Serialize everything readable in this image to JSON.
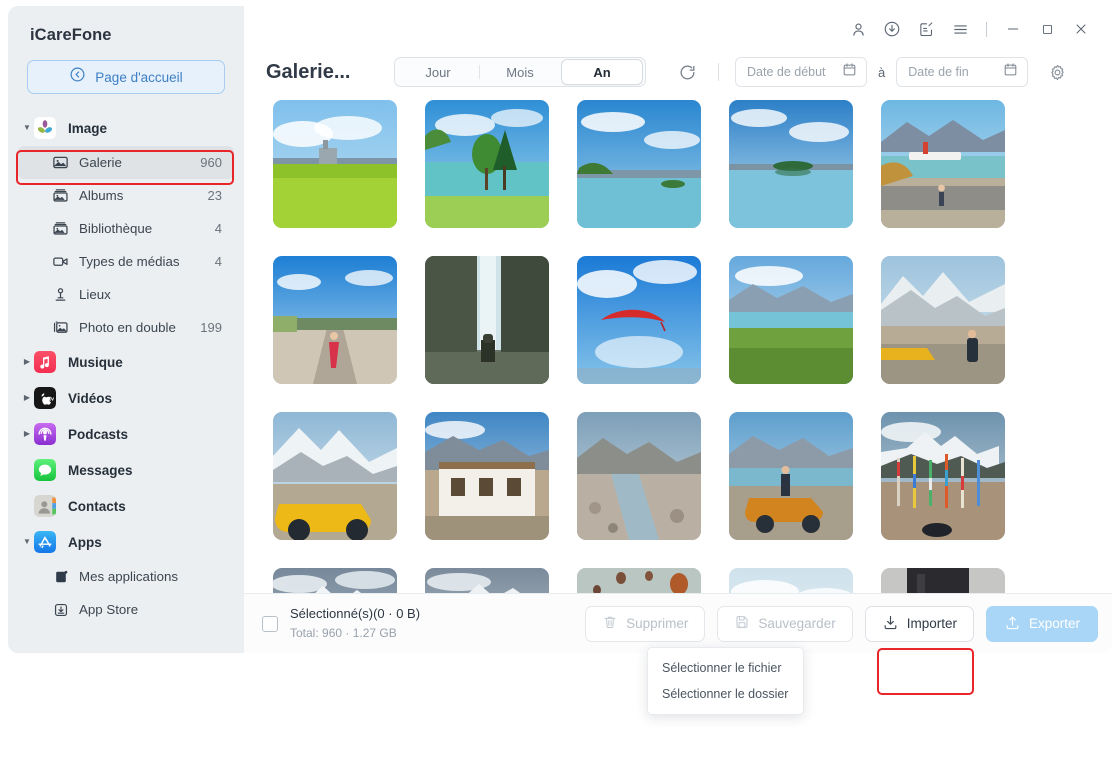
{
  "app": {
    "title": "iCareFone"
  },
  "sidebar": {
    "home_button": {
      "label": "Page d'accueil",
      "icon": "back-circle-icon"
    },
    "groups": [
      {
        "id": "image",
        "label": "Image",
        "expanded": true,
        "icon": "photos-app-icon",
        "items": [
          {
            "id": "galerie",
            "label": "Galerie",
            "count": "960",
            "icon": "picture-icon",
            "active": true,
            "highlighted": true
          },
          {
            "id": "albums",
            "label": "Albums",
            "count": "23",
            "icon": "album-icon",
            "active": false
          },
          {
            "id": "bibliotheque",
            "label": "Bibliothèque",
            "count": "4",
            "icon": "library-icon",
            "active": false
          },
          {
            "id": "types-de-medias",
            "label": "Types de médias",
            "count": "4",
            "icon": "video-camera-icon",
            "active": false
          },
          {
            "id": "lieux",
            "label": "Lieux",
            "count": "",
            "icon": "location-pin-icon",
            "active": false
          },
          {
            "id": "photo-en-double",
            "label": "Photo en double",
            "count": "199",
            "icon": "duplicate-photo-icon",
            "active": false
          }
        ]
      },
      {
        "id": "musique",
        "label": "Musique",
        "expanded": false,
        "icon": "music-app-icon",
        "items": []
      },
      {
        "id": "videos",
        "label": "Vidéos",
        "expanded": false,
        "icon": "appletv-app-icon",
        "items": []
      },
      {
        "id": "podcasts",
        "label": "Podcasts",
        "expanded": false,
        "icon": "podcasts-app-icon",
        "items": []
      },
      {
        "id": "messages",
        "label": "Messages",
        "expanded": null,
        "icon": "messages-app-icon",
        "items": []
      },
      {
        "id": "contacts",
        "label": "Contacts",
        "expanded": null,
        "icon": "contacts-app-icon",
        "items": []
      },
      {
        "id": "apps",
        "label": "Apps",
        "expanded": true,
        "icon": "appstore-app-icon",
        "items": [
          {
            "id": "mes-applications",
            "label": "Mes applications",
            "count": "",
            "icon": "app-grid-icon",
            "active": false
          },
          {
            "id": "app-store",
            "label": "App Store",
            "count": "",
            "icon": "download-box-icon",
            "active": false
          }
        ]
      }
    ]
  },
  "titlebar": {
    "buttons": [
      {
        "id": "account",
        "icon": "user-icon"
      },
      {
        "id": "downloads",
        "icon": "download-circle-icon"
      },
      {
        "id": "feedback",
        "icon": "feedback-note-icon"
      },
      {
        "id": "menu",
        "icon": "hamburger-menu-icon"
      }
    ],
    "window": [
      {
        "id": "minimize",
        "icon": "minimize-icon"
      },
      {
        "id": "maximize",
        "icon": "maximize-icon"
      },
      {
        "id": "close",
        "icon": "close-icon"
      }
    ]
  },
  "toolbar": {
    "page_title": "Galerie...",
    "segments": [
      {
        "id": "jour",
        "label": "Jour",
        "selected": false
      },
      {
        "id": "mois",
        "label": "Mois",
        "selected": false
      },
      {
        "id": "an",
        "label": "An",
        "selected": true
      }
    ],
    "refresh_icon": "refresh-icon",
    "date_start": {
      "placeholder": "Date de début",
      "value": "",
      "icon": "calendar-icon"
    },
    "date_separator": "à",
    "date_end": {
      "placeholder": "Date de fin",
      "value": "",
      "icon": "calendar-icon"
    },
    "settings_icon": "gear-icon"
  },
  "grid": {
    "photos": [
      {
        "id": "p1",
        "alt": "green field with lake and mountains"
      },
      {
        "id": "p2",
        "alt": "two trees on lake shore"
      },
      {
        "id": "p3",
        "alt": "lake with islet and clouds"
      },
      {
        "id": "p4",
        "alt": "calm lake reflection island"
      },
      {
        "id": "p5",
        "alt": "lakeside road with person and steamer"
      },
      {
        "id": "p6",
        "alt": "woman in red dress on road"
      },
      {
        "id": "p7",
        "alt": "hiker facing waterfall in canyon"
      },
      {
        "id": "p8",
        "alt": "red paraglider in blue sky"
      },
      {
        "id": "p9",
        "alt": "lake valley with green hills"
      },
      {
        "id": "p10",
        "alt": "man walking by yellow car in snow mountains"
      },
      {
        "id": "p11",
        "alt": "yellow SUV below snowy peaks"
      },
      {
        "id": "p12",
        "alt": "tibetan style white house"
      },
      {
        "id": "p13",
        "alt": "rocky riverbed and mountains"
      },
      {
        "id": "p14",
        "alt": "man sitting on yellow car by lake"
      },
      {
        "id": "p15",
        "alt": "prayer flags with black yak"
      },
      {
        "id": "p16",
        "alt": "prayer flags and snow mountain"
      },
      {
        "id": "p17",
        "alt": "prayer flags seen past car mirror"
      },
      {
        "id": "p18",
        "alt": "hot air balloons over canyon"
      },
      {
        "id": "p19",
        "alt": "pale lake and distant shore"
      },
      {
        "id": "p20",
        "alt": "yellow rubber ducks by laptop"
      }
    ]
  },
  "bottombar": {
    "checkbox_checked": false,
    "selected_label": "Sélectionné(s)(0 · 0 B)",
    "total_label": "Total: 960 · 1.27 GB",
    "buttons": [
      {
        "id": "supprimer",
        "label": "Supprimer",
        "icon": "trash-icon",
        "enabled": false,
        "primary": false
      },
      {
        "id": "sauvegarder",
        "label": "Sauvegarder",
        "icon": "save-disk-icon",
        "enabled": false,
        "primary": false
      },
      {
        "id": "importer",
        "label": "Importer",
        "icon": "import-download-icon",
        "enabled": true,
        "primary": false,
        "highlighted": true
      },
      {
        "id": "exporter",
        "label": "Exporter",
        "icon": "export-upload-icon",
        "enabled": false,
        "primary": true
      }
    ]
  },
  "dropdown": {
    "open": true,
    "items": [
      {
        "id": "select-file",
        "label": "Sélectionner le fichier"
      },
      {
        "id": "select-folder",
        "label": "Sélectionner le dossier"
      }
    ]
  },
  "colors": {
    "accent": "#3f7fc4",
    "highlight": "#e8262a",
    "sidebar_bg": "#eceff1",
    "primary_button": "#a9d6f7"
  }
}
